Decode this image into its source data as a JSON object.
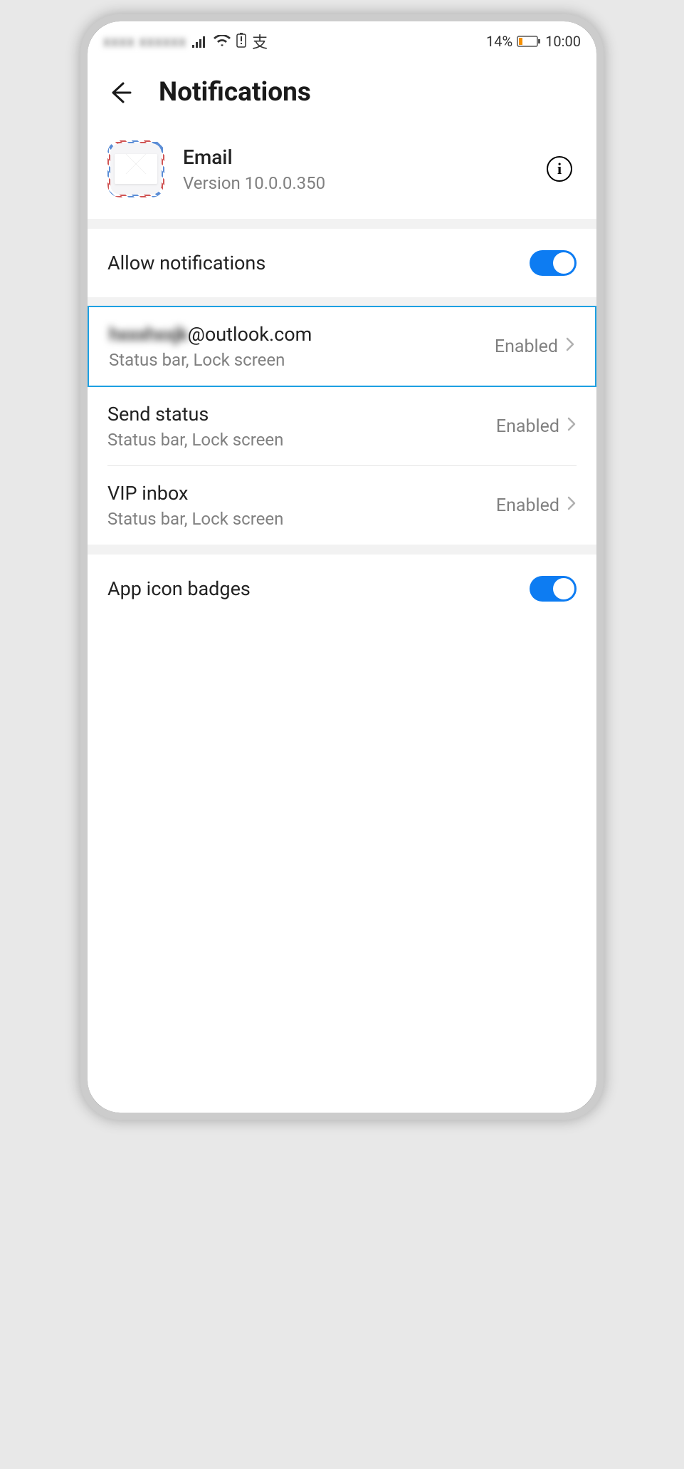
{
  "status_bar": {
    "carrier_blur": "xxxx xxxxxx",
    "battery_pct": "14%",
    "time": "10:00"
  },
  "header": {
    "title": "Notifications"
  },
  "app": {
    "name": "Email",
    "version": "Version 10.0.0.350"
  },
  "settings": {
    "allow_notifications_label": "Allow notifications",
    "app_icon_badges_label": "App icon badges"
  },
  "channels": [
    {
      "title_prefix_blur": "hxxxhxxjk",
      "title_suffix": "@outlook.com",
      "subtitle": "Status bar, Lock screen",
      "status": "Enabled",
      "highlighted": true
    },
    {
      "title": "Send status",
      "subtitle": "Status bar, Lock screen",
      "status": "Enabled"
    },
    {
      "title": "VIP inbox",
      "subtitle": "Status bar, Lock screen",
      "status": "Enabled"
    }
  ]
}
